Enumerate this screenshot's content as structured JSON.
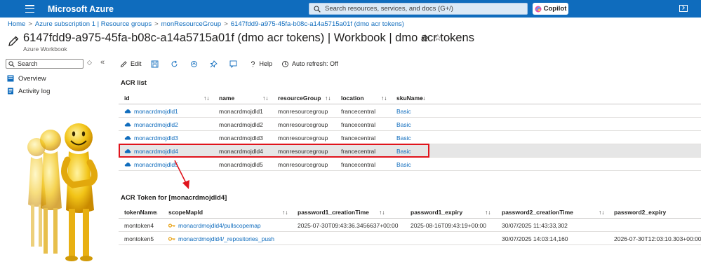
{
  "topbar": {
    "brand": "Microsoft Azure",
    "search_placeholder": "Search resources, services, and docs (G+/)",
    "copilot_label": "Copilot"
  },
  "breadcrumb": [
    "Home",
    "Azure subscription 1 | Resource groups",
    "monResourceGroup",
    "6147fdd9-a975-45fa-b08c-a14a5715a01f (dmo acr tokens)"
  ],
  "header": {
    "title": "6147fdd9-a975-45fa-b08c-a14a5715a01f (dmo acr tokens) | Workbook | dmo acr tokens",
    "subtitle": "Azure Workbook",
    "more": "..."
  },
  "nav": {
    "search_placeholder": "Search",
    "items": [
      "Overview",
      "Activity log"
    ]
  },
  "toolbar": {
    "edit": "Edit",
    "help": "Help",
    "auto_refresh": "Auto refresh: Off"
  },
  "acr_list": {
    "title": "ACR list",
    "columns": [
      "id",
      "name",
      "resourceGroup",
      "location",
      "skuName"
    ],
    "rows": [
      {
        "id": "monacrdmojdld1",
        "name": "monacrdmojdld1",
        "resourceGroup": "monresourcegroup",
        "location": "francecentral",
        "skuName": "Basic"
      },
      {
        "id": "monacrdmojdld2",
        "name": "monacrdmojdld2",
        "resourceGroup": "monresourcegroup",
        "location": "francecentral",
        "skuName": "Basic"
      },
      {
        "id": "monacrdmojdld3",
        "name": "monacrdmojdld3",
        "resourceGroup": "monresourcegroup",
        "location": "francecentral",
        "skuName": "Basic"
      },
      {
        "id": "monacrdmojdld4",
        "name": "monacrdmojdld4",
        "resourceGroup": "monresourcegroup",
        "location": "francecentral",
        "skuName": "Basic"
      },
      {
        "id": "monacrdmojdld5",
        "name": "monacrdmojdld5",
        "resourceGroup": "monresourcegroup",
        "location": "francecentral",
        "skuName": "Basic"
      }
    ],
    "selected_index": 3
  },
  "token_list": {
    "title": "ACR Token for [monacrdmojdld4]",
    "columns": [
      "tokenName",
      "scopeMapId",
      "password1_creationTime",
      "password1_expiry",
      "password2_creationTime",
      "password2_expiry"
    ],
    "rows": [
      {
        "tokenName": "montoken4",
        "scopeMapId": "monacrdmojdld4/pullscopemap",
        "password1_creationTime": "2025-07-30T09:43:36.3456637+00:00",
        "password1_expiry": "2025-08-16T09:43:19+00:00",
        "password2_creationTime": "30/07/2025 11:43:33,302",
        "password2_expiry": ""
      },
      {
        "tokenName": "montoken5",
        "scopeMapId": "monacrdmojdld4/_repositories_push",
        "password1_creationTime": "",
        "password1_expiry": "",
        "password2_creationTime": "30/07/2025 14:03:14,160",
        "password2_expiry": "2026-07-30T12:03:10.303+00:00"
      }
    ]
  },
  "sort_glyph": "↑↓",
  "colors": {
    "topbar": "#0f6cbd",
    "link": "#0f6cbd",
    "highlight": "#e0141c",
    "selected_row": "#e6e6e6"
  },
  "icons": [
    "hamburger-icon",
    "search-icon",
    "copilot-icon",
    "terminal-icon",
    "edit-icon",
    "pin-icon",
    "star-icon",
    "cloud-icon",
    "key-icon",
    "refresh-icon",
    "save-icon",
    "help-icon"
  ]
}
